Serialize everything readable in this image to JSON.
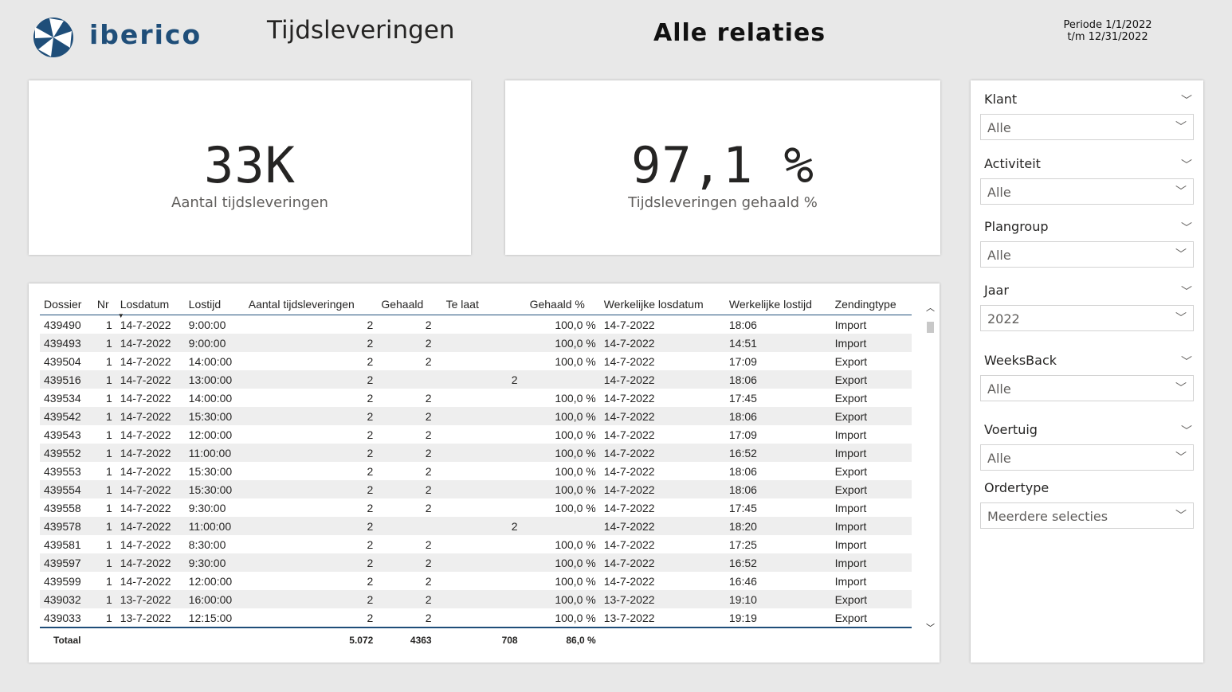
{
  "header": {
    "logo_text": "iberico",
    "title": "Tijdsleveringen",
    "subtitle": "Alle relaties",
    "period_line1": "Periode 1/1/2022",
    "period_line2": "t/m 12/31/2022"
  },
  "kpis": [
    {
      "value": "33K",
      "label": "Aantal tijdsleveringen"
    },
    {
      "value": "97,1 %",
      "label": "Tijdsleveringen gehaald %"
    }
  ],
  "table": {
    "columns": [
      "Dossier",
      "Nr",
      "Losdatum",
      "Lostijd",
      "Aantal tijdsleveringen",
      "Gehaald",
      "Te laat",
      "Gehaald %",
      "Werkelijke losdatum",
      "Werkelijke lostijd",
      "Zendingtype"
    ],
    "rows": [
      [
        "439490",
        "1",
        "14-7-2022",
        "9:00:00",
        "2",
        "2",
        "",
        "100,0 %",
        "14-7-2022",
        "18:06",
        "Import"
      ],
      [
        "439493",
        "1",
        "14-7-2022",
        "9:00:00",
        "2",
        "2",
        "",
        "100,0 %",
        "14-7-2022",
        "14:51",
        "Import"
      ],
      [
        "439504",
        "1",
        "14-7-2022",
        "14:00:00",
        "2",
        "2",
        "",
        "100,0 %",
        "14-7-2022",
        "17:09",
        "Export"
      ],
      [
        "439516",
        "1",
        "14-7-2022",
        "13:00:00",
        "2",
        "",
        "2",
        "",
        "14-7-2022",
        "18:06",
        "Export"
      ],
      [
        "439534",
        "1",
        "14-7-2022",
        "14:00:00",
        "2",
        "2",
        "",
        "100,0 %",
        "14-7-2022",
        "17:45",
        "Export"
      ],
      [
        "439542",
        "1",
        "14-7-2022",
        "15:30:00",
        "2",
        "2",
        "",
        "100,0 %",
        "14-7-2022",
        "18:06",
        "Export"
      ],
      [
        "439543",
        "1",
        "14-7-2022",
        "12:00:00",
        "2",
        "2",
        "",
        "100,0 %",
        "14-7-2022",
        "17:09",
        "Import"
      ],
      [
        "439552",
        "1",
        "14-7-2022",
        "11:00:00",
        "2",
        "2",
        "",
        "100,0 %",
        "14-7-2022",
        "16:52",
        "Import"
      ],
      [
        "439553",
        "1",
        "14-7-2022",
        "15:30:00",
        "2",
        "2",
        "",
        "100,0 %",
        "14-7-2022",
        "18:06",
        "Export"
      ],
      [
        "439554",
        "1",
        "14-7-2022",
        "15:30:00",
        "2",
        "2",
        "",
        "100,0 %",
        "14-7-2022",
        "18:06",
        "Export"
      ],
      [
        "439558",
        "1",
        "14-7-2022",
        "9:30:00",
        "2",
        "2",
        "",
        "100,0 %",
        "14-7-2022",
        "17:45",
        "Import"
      ],
      [
        "439578",
        "1",
        "14-7-2022",
        "11:00:00",
        "2",
        "",
        "2",
        "",
        "14-7-2022",
        "18:20",
        "Import"
      ],
      [
        "439581",
        "1",
        "14-7-2022",
        "8:30:00",
        "2",
        "2",
        "",
        "100,0 %",
        "14-7-2022",
        "17:25",
        "Import"
      ],
      [
        "439597",
        "1",
        "14-7-2022",
        "9:30:00",
        "2",
        "2",
        "",
        "100,0 %",
        "14-7-2022",
        "16:52",
        "Import"
      ],
      [
        "439599",
        "1",
        "14-7-2022",
        "12:00:00",
        "2",
        "2",
        "",
        "100,0 %",
        "14-7-2022",
        "16:46",
        "Import"
      ],
      [
        "439032",
        "1",
        "13-7-2022",
        "16:00:00",
        "2",
        "2",
        "",
        "100,0 %",
        "13-7-2022",
        "19:10",
        "Export"
      ],
      [
        "439033",
        "1",
        "13-7-2022",
        "12:15:00",
        "2",
        "2",
        "",
        "100,0 %",
        "13-7-2022",
        "19:19",
        "Export"
      ]
    ],
    "totals": {
      "label": "Totaal",
      "aantal": "5.072",
      "gehaald": "4363",
      "te_laat": "708",
      "gehaald_pct": "86,0 %"
    }
  },
  "slicers": [
    {
      "title": "Klant",
      "value": "Alle",
      "collapsible": true
    },
    {
      "title": "Activiteit",
      "value": "Alle",
      "collapsible": true
    },
    {
      "title": "Plangroup",
      "value": "Alle",
      "collapsible": true
    },
    {
      "title": "Jaar",
      "value": "2022",
      "collapsible": true
    },
    {
      "title": "WeeksBack",
      "value": "Alle",
      "collapsible": true
    },
    {
      "title": "Voertuig",
      "value": "Alle",
      "collapsible": true
    },
    {
      "title": "Ordertype",
      "value": "Meerdere selecties",
      "collapsible": false
    }
  ],
  "colors": {
    "brand": "#1f4e79",
    "background": "#e8e8e8",
    "card": "#ffffff",
    "row_alt": "#eeeeee"
  },
  "icons": [
    "iberico-logo-icon",
    "chevron-down-icon",
    "sort-descending-icon",
    "scroll-up-icon",
    "scroll-down-icon"
  ]
}
